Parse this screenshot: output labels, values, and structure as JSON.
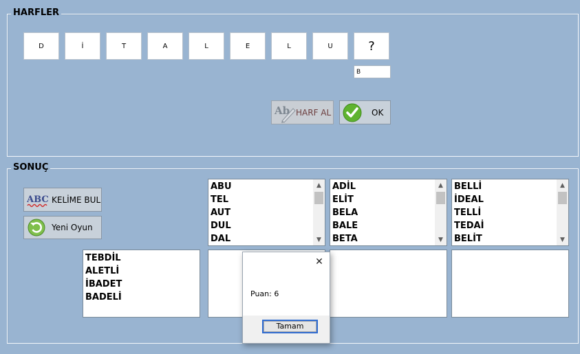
{
  "harfler": {
    "title": "HARFLER",
    "letters": [
      "D",
      "İ",
      "T",
      "A",
      "L",
      "E",
      "L",
      "U",
      "?"
    ],
    "input_value": "B",
    "harf_al_label": "HARF AL",
    "ok_label": "OK"
  },
  "sonuc": {
    "title": "SONUÇ",
    "kelime_bul_label": "KELİME BUL",
    "yeni_oyun_label": "Yeni Oyun",
    "list1": [
      "ABU",
      "TEL",
      "AUT",
      "DUL",
      "DAL"
    ],
    "list2": [
      "ADİL",
      "ELİT",
      "BELA",
      "BALE",
      "BETA"
    ],
    "list3": [
      "BELLİ",
      "İDEAL",
      "TELLİ",
      "TEDAİ",
      "BELİT"
    ],
    "list4": [
      "TEBDİL",
      "ALETLİ",
      "İBADET",
      "BADELİ"
    ]
  },
  "dialog": {
    "message": "Puan: 6",
    "button": "Tamam",
    "close_glyph": "✕"
  },
  "colors": {
    "background": "#99b4d1",
    "ok_check": "#5fb32f",
    "harf_al_text": "#6c3d3d"
  }
}
